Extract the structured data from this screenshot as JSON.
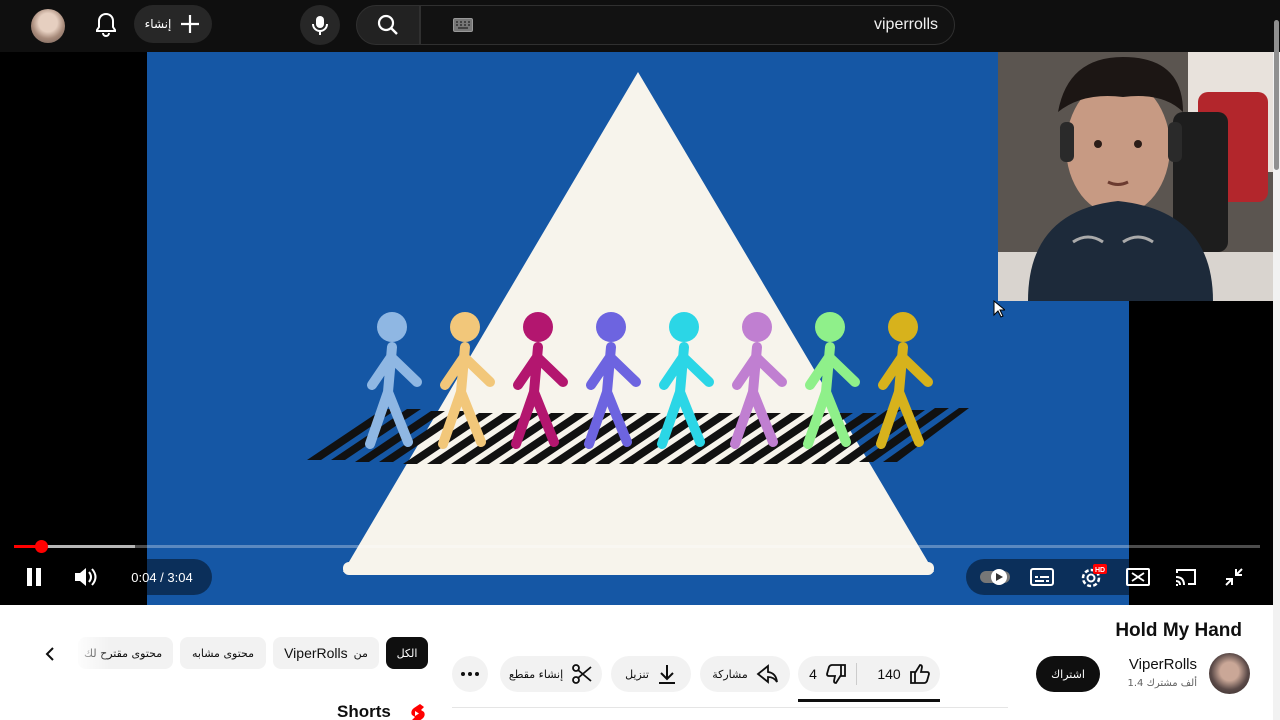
{
  "topbar": {
    "search_query": "viperrolls",
    "create_label": "إنشاء",
    "icons": [
      "avatar",
      "bell-icon",
      "plus-icon",
      "mic-icon",
      "search-icon",
      "keyboard-icon"
    ]
  },
  "player": {
    "time_display": "0:04 / 3:04",
    "progress_fraction": 0.022,
    "buffered_fraction": 0.097,
    "hd_badge": "HD",
    "accent": "#ff0000",
    "video_background": "#1557a5",
    "figure_colors": [
      "#8fb7e3",
      "#f2c77a",
      "#b3166f",
      "#6d64e0",
      "#2bd6e6",
      "#c07fd1",
      "#8ff08a",
      "#d7b21c"
    ]
  },
  "video_info": {
    "title": "Hold My Hand",
    "channel_name": "ViperRolls",
    "subscribers": "1.4 ألف مشترك",
    "subscribe_label": "اشتراك",
    "likes": "140",
    "dislikes": "4",
    "share_label": "مشاركة",
    "download_label": "تنزيل",
    "clip_label": "إنشاء مقطع"
  },
  "chips": {
    "all": "الكل",
    "from_prefix": "من",
    "from_channel": "ViperRolls",
    "related": "محتوى مشابه",
    "recommended": "محتوى مقترح لك"
  },
  "shorts_label": "Shorts"
}
